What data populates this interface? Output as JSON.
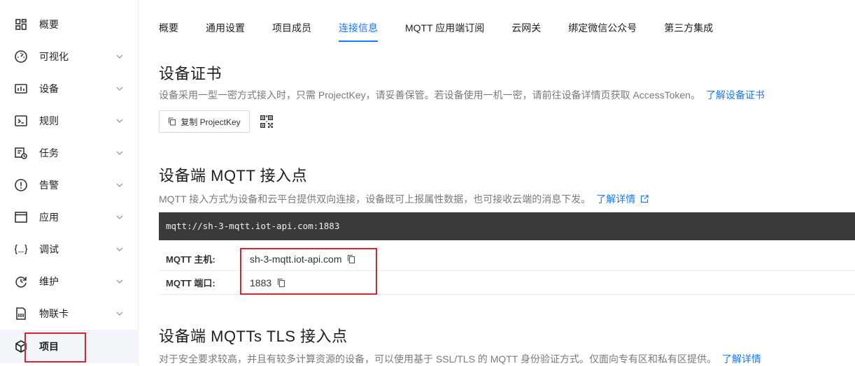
{
  "sidebar": {
    "items": [
      {
        "label": "概要",
        "icon": "dashboard-icon",
        "chevron": false
      },
      {
        "label": "可视化",
        "icon": "gauge-icon",
        "chevron": true
      },
      {
        "label": "设备",
        "icon": "device-icon",
        "chevron": true
      },
      {
        "label": "规则",
        "icon": "terminal-icon",
        "chevron": true
      },
      {
        "label": "任务",
        "icon": "task-icon",
        "chevron": true
      },
      {
        "label": "告警",
        "icon": "alert-icon",
        "chevron": true
      },
      {
        "label": "应用",
        "icon": "window-icon",
        "chevron": true
      },
      {
        "label": "调试",
        "icon": "braces-icon",
        "chevron": true
      },
      {
        "label": "维护",
        "icon": "refresh-icon",
        "chevron": true
      },
      {
        "label": "物联卡",
        "icon": "sim-card-icon",
        "chevron": true
      },
      {
        "label": "项目",
        "icon": "cube-icon",
        "chevron": false,
        "active": true
      }
    ]
  },
  "tabs": [
    {
      "label": "概要"
    },
    {
      "label": "通用设置"
    },
    {
      "label": "项目成员"
    },
    {
      "label": "连接信息",
      "active": true
    },
    {
      "label": "MQTT 应用端订阅"
    },
    {
      "label": "云网关"
    },
    {
      "label": "绑定微信公众号"
    },
    {
      "label": "第三方集成"
    }
  ],
  "cert": {
    "title": "设备证书",
    "desc": "设备采用一型一密方式接入时，只需 ProjectKey，请妥善保管。若设备使用一机一密，请前往设备详情页获取 AccessToken。",
    "link": "了解设备证书",
    "copy_button": "复制 ProjectKey"
  },
  "mqtt": {
    "title": "设备端 MQTT 接入点",
    "desc": "MQTT 接入方式为设备和云平台提供双向连接，设备既可上报属性数据，也可接收云端的消息下发。",
    "link": "了解详情",
    "url": "mqtt://sh-3-mqtt.iot-api.com:1883",
    "host_label": "MQTT 主机:",
    "host_value": "sh-3-mqtt.iot-api.com",
    "port_label": "MQTT 端口:",
    "port_value": "1883"
  },
  "mqtts": {
    "title": "设备端 MQTTs TLS 接入点",
    "desc": "对于安全要求较高，并且有较多计算资源的设备，可以使用基于 SSL/TLS 的 MQTT 身份验证方式。仅面向专有区和私有区提供。",
    "link": "了解详情"
  },
  "colors": {
    "accent": "#1677ff",
    "highlight": "#d9232d",
    "codebar": "#3a3a3a"
  }
}
